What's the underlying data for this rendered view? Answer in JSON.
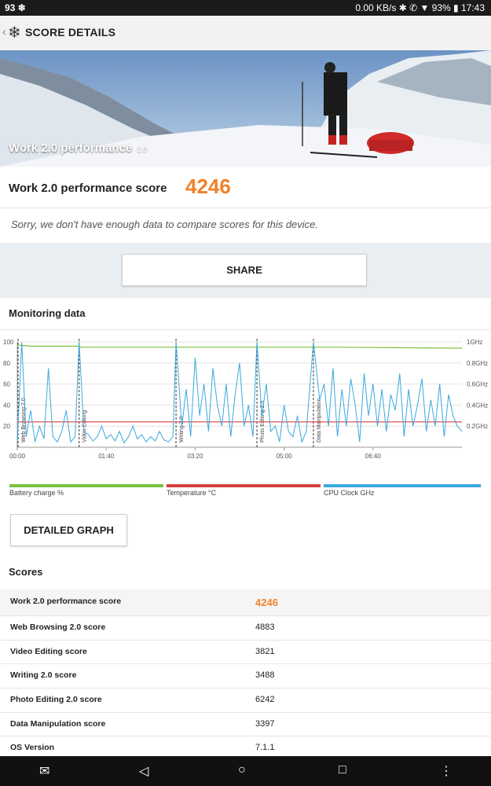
{
  "status_bar": {
    "left": "93 ❄",
    "right": "0.00 KB/s  ✱  ✆  ▼  93%  ▮ 17:43"
  },
  "app_bar": {
    "title": "SCORE DETAILS"
  },
  "hero": {
    "title": "Work 2.0 performance",
    "version": "2.0"
  },
  "score": {
    "label": "Work 2.0 performance score",
    "value": "4246"
  },
  "notice": "Sorry, we don't have enough data to compare scores for this device.",
  "share_label": "SHARE",
  "monitoring": {
    "title": "Monitoring data",
    "legend": [
      {
        "label": "Battery charge %",
        "color": "#7cc23f"
      },
      {
        "label": "Temperature °C",
        "color": "#d8403c"
      },
      {
        "label": "CPU Clock GHz",
        "color": "#3aa8e0"
      }
    ]
  },
  "chart_data": {
    "type": "line",
    "x_ticks": [
      "00:00",
      "01:40",
      "03:20",
      "05:00",
      "06:40"
    ],
    "y_ticks_left": [
      "100",
      "80",
      "60",
      "40",
      "20"
    ],
    "y_ticks_right": [
      "1GHz",
      "0.8GHz",
      "0.6GHz",
      "0.4GHz",
      "0.2GHz"
    ],
    "ylim_left": [
      0,
      100
    ],
    "ylim_right": [
      0,
      1.0
    ],
    "sections": [
      {
        "label": "Web Browsing 2.0",
        "start_frac": 0.0
      },
      {
        "label": "Video Editing",
        "start_frac": 0.139
      },
      {
        "label": "Writing 2.0",
        "start_frac": 0.357
      },
      {
        "label": "Photo Editing 2.0",
        "start_frac": 0.539
      },
      {
        "label": "Data Manipulation",
        "start_frac": 0.666
      }
    ],
    "series": [
      {
        "name": "Battery charge %",
        "color": "#7cc23f",
        "x": [
          0,
          0.03,
          0.139,
          0.14,
          0.72,
          1.0
        ],
        "y": [
          97,
          96,
          96,
          95,
          95,
          94
        ]
      },
      {
        "name": "Temperature °C",
        "color": "#d8403c",
        "x": [
          0,
          1.0
        ],
        "y": [
          24,
          24
        ]
      },
      {
        "name": "CPU Clock GHz",
        "color": "#3aa8e0",
        "x": [
          0,
          0.01,
          0.02,
          0.03,
          0.04,
          0.05,
          0.06,
          0.07,
          0.08,
          0.09,
          0.1,
          0.11,
          0.12,
          0.13,
          0.139,
          0.15,
          0.16,
          0.17,
          0.18,
          0.19,
          0.2,
          0.21,
          0.22,
          0.23,
          0.24,
          0.25,
          0.26,
          0.27,
          0.28,
          0.29,
          0.3,
          0.31,
          0.32,
          0.33,
          0.34,
          0.35,
          0.357,
          0.37,
          0.38,
          0.39,
          0.4,
          0.41,
          0.42,
          0.43,
          0.44,
          0.45,
          0.46,
          0.47,
          0.48,
          0.49,
          0.5,
          0.51,
          0.52,
          0.53,
          0.539,
          0.55,
          0.56,
          0.57,
          0.58,
          0.59,
          0.6,
          0.61,
          0.62,
          0.63,
          0.64,
          0.65,
          0.666,
          0.68,
          0.69,
          0.7,
          0.71,
          0.72,
          0.73,
          0.74,
          0.75,
          0.76,
          0.77,
          0.78,
          0.79,
          0.8,
          0.81,
          0.82,
          0.83,
          0.84,
          0.85,
          0.86,
          0.87,
          0.88,
          0.89,
          0.9,
          0.91,
          0.92,
          0.93,
          0.94,
          0.95,
          0.96,
          0.97,
          0.98,
          0.99,
          1.0
        ],
        "y": [
          0.05,
          1.0,
          0.1,
          0.35,
          0.05,
          0.2,
          0.08,
          0.75,
          0.1,
          0.05,
          0.15,
          0.35,
          0.05,
          0.1,
          1.0,
          0.15,
          0.12,
          0.06,
          0.1,
          0.2,
          0.08,
          0.12,
          0.06,
          0.15,
          0.04,
          0.1,
          0.2,
          0.08,
          0.12,
          0.05,
          0.1,
          0.06,
          0.15,
          0.07,
          0.05,
          0.1,
          1.0,
          0.2,
          0.55,
          0.1,
          0.85,
          0.3,
          0.6,
          0.15,
          0.75,
          0.4,
          0.2,
          0.6,
          0.1,
          0.5,
          0.8,
          0.2,
          0.4,
          0.1,
          1.0,
          0.3,
          0.6,
          0.15,
          0.2,
          0.05,
          0.4,
          0.15,
          0.1,
          0.3,
          0.05,
          0.15,
          1.0,
          0.45,
          0.6,
          0.2,
          0.75,
          0.1,
          0.55,
          0.2,
          0.65,
          0.4,
          0.05,
          0.7,
          0.3,
          0.6,
          0.2,
          0.55,
          0.15,
          0.5,
          0.35,
          0.7,
          0.1,
          0.55,
          0.2,
          0.4,
          0.65,
          0.15,
          0.45,
          0.2,
          0.6,
          0.1,
          0.5,
          0.3,
          0.2,
          0.15
        ]
      }
    ]
  },
  "detailed_graph_label": "DETAILED GRAPH",
  "scores": {
    "title": "Scores",
    "rows": [
      {
        "label": "Work 2.0 performance score",
        "value": "4246"
      },
      {
        "label": "Web Browsing 2.0 score",
        "value": "4883"
      },
      {
        "label": "Video Editing score",
        "value": "3821"
      },
      {
        "label": "Writing 2.0 score",
        "value": "3488"
      },
      {
        "label": "Photo Editing 2.0 score",
        "value": "6242"
      },
      {
        "label": "Data Manipulation score",
        "value": "3397"
      },
      {
        "label": "OS Version",
        "value": "7.1.1"
      }
    ]
  },
  "nav": {
    "mail": "✉",
    "back": "◁",
    "home": "○",
    "recents": "□",
    "more": "⋮"
  }
}
